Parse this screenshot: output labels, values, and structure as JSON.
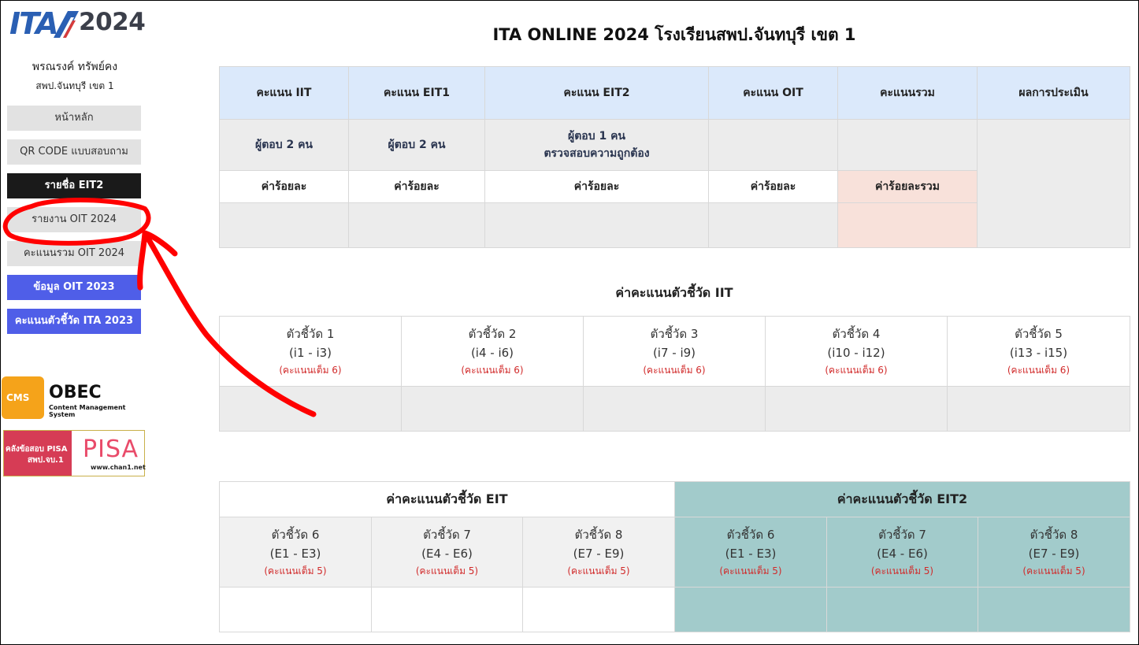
{
  "logo": {
    "brand": "ITA",
    "year": "2024"
  },
  "user": {
    "name": "พรณรงค์ ทรัพย์คง",
    "org": "สพป.จันทบุรี เขต 1"
  },
  "sidebar": {
    "items": [
      {
        "label": "หน้าหลัก"
      },
      {
        "label": "QR CODE แบบสอบถาม"
      },
      {
        "label": "รายชื่อ EIT2"
      },
      {
        "label": "รายงาน OIT 2024"
      },
      {
        "label": "คะแนนรวม OIT 2024"
      },
      {
        "label": "ข้อมูล OIT 2023"
      },
      {
        "label": "คะแนนตัวชี้วัด ITA 2023"
      }
    ]
  },
  "banners": {
    "obec": {
      "box_letters": "CMS",
      "title": "OBEC",
      "subtitle": "Content Management System"
    },
    "pisa": {
      "line1": "คลังข้อสอบ PISA",
      "line2": "สพป.จบ.1",
      "word": "PISA",
      "url": "www.chan1.net"
    }
  },
  "page": {
    "title": "ITA ONLINE 2024 โรงเรียนสพป.จันทบุรี เขต 1"
  },
  "score_table": {
    "headers": [
      "คะแนน IIT",
      "คะแนน EIT1",
      "คะแนน EIT2",
      "คะแนน OIT",
      "คะแนนรวม",
      "ผลการประเมิน"
    ],
    "respondents": [
      "ผู้ตอบ 2 คน",
      "ผู้ตอบ 2 คน",
      "ผู้ตอบ 1 คน",
      "ตรวจสอบความถูกต้อง"
    ],
    "percent_labels": [
      "ค่าร้อยละ",
      "ค่าร้อยละ",
      "ค่าร้อยละ",
      "ค่าร้อยละ",
      "ค่าร้อยละรวม"
    ]
  },
  "iit": {
    "title": "ค่าคะแนนตัวชี้วัด IIT",
    "indicators": [
      {
        "name": "ตัวชี้วัด 1",
        "range": "(i1 - i3)",
        "full": "(คะแนนเต็ม 6)"
      },
      {
        "name": "ตัวชี้วัด 2",
        "range": "(i4 - i6)",
        "full": "(คะแนนเต็ม 6)"
      },
      {
        "name": "ตัวชี้วัด 3",
        "range": "(i7 - i9)",
        "full": "(คะแนนเต็ม 6)"
      },
      {
        "name": "ตัวชี้วัด 4",
        "range": "(i10 - i12)",
        "full": "(คะแนนเต็ม 6)"
      },
      {
        "name": "ตัวชี้วัด 5",
        "range": "(i13 - i15)",
        "full": "(คะแนนเต็ม 6)"
      }
    ]
  },
  "eit": {
    "title": "ค่าคะแนนตัวชี้วัด EIT",
    "indicators": [
      {
        "name": "ตัวชี้วัด 6",
        "range": "(E1 - E3)",
        "full": "(คะแนนเต็ม 5)"
      },
      {
        "name": "ตัวชี้วัด 7",
        "range": "(E4 - E6)",
        "full": "(คะแนนเต็ม 5)"
      },
      {
        "name": "ตัวชี้วัด 8",
        "range": "(E7 - E9)",
        "full": "(คะแนนเต็ม 5)"
      }
    ]
  },
  "eit2": {
    "title": "ค่าคะแนนตัวชี้วัด EIT2",
    "indicators": [
      {
        "name": "ตัวชี้วัด 6",
        "range": "(E1 - E3)",
        "full": "(คะแนนเต็ม 5)"
      },
      {
        "name": "ตัวชี้วัด 7",
        "range": "(E4 - E6)",
        "full": "(คะแนนเต็ม 5)"
      },
      {
        "name": "ตัวชี้วัด 8",
        "range": "(E7 - E9)",
        "full": "(คะแนนเต็ม 5)"
      }
    ]
  },
  "colors": {
    "header_blue": "#dbe9fb",
    "teal": "#a2cbcb",
    "pink": "#f8e1da",
    "nav_blue": "#4f5ee8",
    "nav_dark": "#1a1a1a",
    "annotation_red": "#ff0000"
  }
}
